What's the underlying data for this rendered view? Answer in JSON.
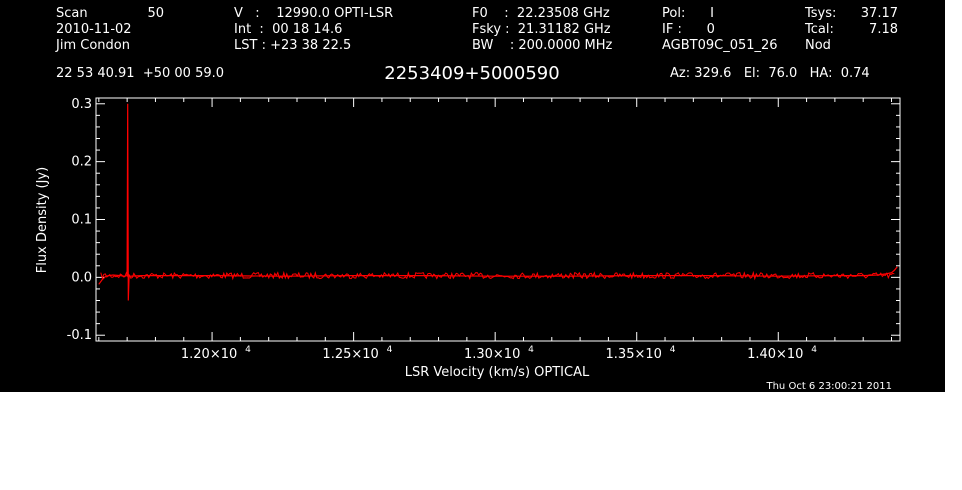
{
  "header": {
    "scan_label": "Scan",
    "scan_value": "50",
    "date": "2010-11-02",
    "observer": "Jim Condon",
    "velocity": "V   :    12990.0 OPTI-LSR",
    "integration": "Int  :  00 18 14.6",
    "lst": "LST : +23 38 22.5",
    "f0": "F0    :  22.23508 GHz",
    "fsky": "Fsky :  21.31182 GHz",
    "bw": "BW    : 200.0000 MHz",
    "pol": "Pol:      I",
    "if": "IF :      0",
    "project": "AGBT09C_051_26",
    "tsys_label": "Tsys:",
    "tsys_value": "37.17",
    "tcal_label": "Tcal:",
    "tcal_value": "7.18",
    "mode": "Nod",
    "coordinates": "22 53 40.91  +50 00 59.0",
    "source": "2253409+5000590",
    "pointing": "Az: 329.6   El:  76.0   HA:  0.74"
  },
  "timestamp": "Thu Oct  6 23:00:21 2011",
  "colors": {
    "background": "#000000",
    "axes": "#ffffff",
    "spectrum": "#ff0000"
  },
  "chart_data": {
    "type": "line",
    "title": "2253409+5000590",
    "xlabel": "LSR Velocity (km/s) OPTICAL",
    "ylabel": "Flux Density (Jy)",
    "xlim": [
      11590,
      14430
    ],
    "ylim": [
      -0.11,
      0.31
    ],
    "x_ticks": [
      {
        "value": 12000,
        "mantissa": "1.20",
        "exponent": "4"
      },
      {
        "value": 12500,
        "mantissa": "1.25",
        "exponent": "4"
      },
      {
        "value": 13000,
        "mantissa": "1.30",
        "exponent": "4"
      },
      {
        "value": 13500,
        "mantissa": "1.35",
        "exponent": "4"
      },
      {
        "value": 14000,
        "mantissa": "1.40",
        "exponent": "4"
      }
    ],
    "y_ticks": [
      {
        "value": 0.3,
        "label": "0.3"
      },
      {
        "value": 0.2,
        "label": "0.2"
      },
      {
        "value": 0.1,
        "label": "0.1"
      },
      {
        "value": 0.0,
        "label": "0.0"
      },
      {
        "value": -0.1,
        "label": "-0.1"
      }
    ],
    "grid": false,
    "series": [
      {
        "color": "#ff0000",
        "x": [
          11600,
          11612,
          11625,
          11650,
          11675,
          11690,
          11700,
          11702,
          11704,
          11707,
          11710,
          11750,
          11800,
          11900,
          12000,
          12250,
          12500,
          12750,
          13000,
          13250,
          13500,
          13750,
          14000,
          14200,
          14300,
          14350,
          14380,
          14400,
          14410,
          14420
        ],
        "y": [
          -0.012,
          -0.004,
          0.002,
          0.004,
          0.003,
          0.002,
          0.003,
          0.3,
          -0.04,
          0.004,
          0.002,
          0.003,
          0.003,
          0.003,
          0.003,
          0.002,
          0.003,
          0.003,
          0.002,
          0.002,
          0.003,
          0.003,
          0.002,
          0.003,
          0.003,
          0.004,
          0.006,
          0.008,
          0.012,
          0.018
        ]
      }
    ]
  }
}
